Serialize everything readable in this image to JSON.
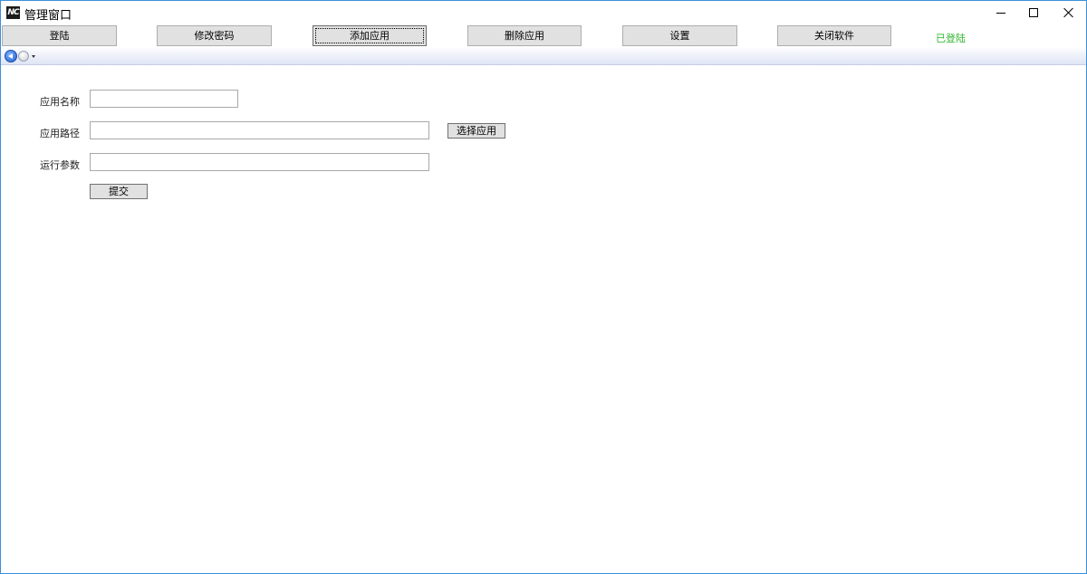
{
  "window": {
    "title": "管理窗口",
    "icon_text": "NC"
  },
  "title_controls": [
    "minimize-icon",
    "maximize-icon",
    "close-icon"
  ],
  "toolbar": {
    "buttons": [
      {
        "label": "登陆"
      },
      {
        "label": "修改密码"
      },
      {
        "label": "添加应用"
      },
      {
        "label": "删除应用"
      },
      {
        "label": "设置"
      },
      {
        "label": "关闭软件"
      }
    ],
    "status": "已登陆",
    "status_color": "#2db52d"
  },
  "nav": {
    "icons": [
      "back-arrow-icon",
      "forward-arrow-icon",
      "dropdown-arrow-icon"
    ]
  },
  "form": {
    "app_name": {
      "label": "应用名称",
      "value": ""
    },
    "app_path": {
      "label": "应用路径",
      "value": "",
      "browse_label": "选择应用"
    },
    "run_args": {
      "label": "运行参数",
      "value": ""
    },
    "submit_label": "提交"
  }
}
